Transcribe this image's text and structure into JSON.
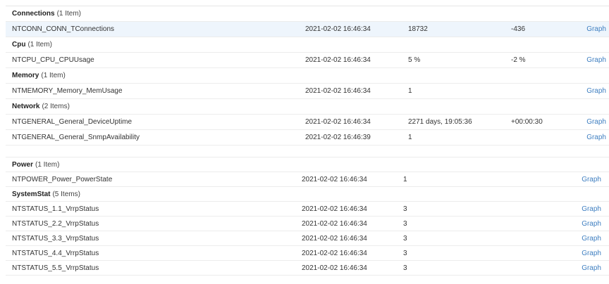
{
  "panels": [
    {
      "groups": [
        {
          "name": "Connections",
          "count": "(1 Item)",
          "rows": [
            {
              "name": "NTCONN_CONN_TConnections",
              "time": "2021-02-02 16:46:34",
              "value": "18732",
              "change": "-436",
              "link": "Graph",
              "highlighted": true
            }
          ]
        },
        {
          "name": "Cpu",
          "count": "(1 Item)",
          "rows": [
            {
              "name": "NTCPU_CPU_CPUUsage",
              "time": "2021-02-02 16:46:34",
              "value": "5 %",
              "change": "-2 %",
              "link": "Graph"
            }
          ]
        },
        {
          "name": "Memory",
          "count": "(1 Item)",
          "rows": [
            {
              "name": "NTMEMORY_Memory_MemUsage",
              "time": "2021-02-02 16:46:34",
              "value": "1",
              "change": "",
              "link": "Graph"
            }
          ]
        },
        {
          "name": "Network",
          "count": "(2 Items)",
          "rows": [
            {
              "name": "NTGENERAL_General_DeviceUptime",
              "time": "2021-02-02 16:46:34",
              "value": "2271 days, 19:05:36",
              "change": "+00:00:30",
              "link": "Graph"
            },
            {
              "name": "NTGENERAL_General_SnmpAvailability",
              "time": "2021-02-02 16:46:39",
              "value": "1",
              "change": "",
              "link": "Graph"
            }
          ]
        }
      ]
    },
    {
      "groups": [
        {
          "name": "Power",
          "count": "(1 Item)",
          "rows": [
            {
              "name": "NTPOWER_Power_PowerState",
              "time": "2021-02-02 16:46:34",
              "value": "1",
              "change": "",
              "link": "Graph"
            }
          ]
        },
        {
          "name": "SystemStat",
          "count": "(5 Items)",
          "rows": [
            {
              "name": "NTSTATUS_1.1_VrrpStatus",
              "time": "2021-02-02 16:46:34",
              "value": "3",
              "change": "",
              "link": "Graph"
            },
            {
              "name": "NTSTATUS_2.2_VrrpStatus",
              "time": "2021-02-02 16:46:34",
              "value": "3",
              "change": "",
              "link": "Graph"
            },
            {
              "name": "NTSTATUS_3.3_VrrpStatus",
              "time": "2021-02-02 16:46:34",
              "value": "3",
              "change": "",
              "link": "Graph"
            },
            {
              "name": "NTSTATUS_4.4_VrrpStatus",
              "time": "2021-02-02 16:46:34",
              "value": "3",
              "change": "",
              "link": "Graph"
            },
            {
              "name": "NTSTATUS_5.5_VrrpStatus",
              "time": "2021-02-02 16:46:34",
              "value": "3",
              "change": "",
              "link": "Graph"
            }
          ]
        }
      ]
    }
  ]
}
